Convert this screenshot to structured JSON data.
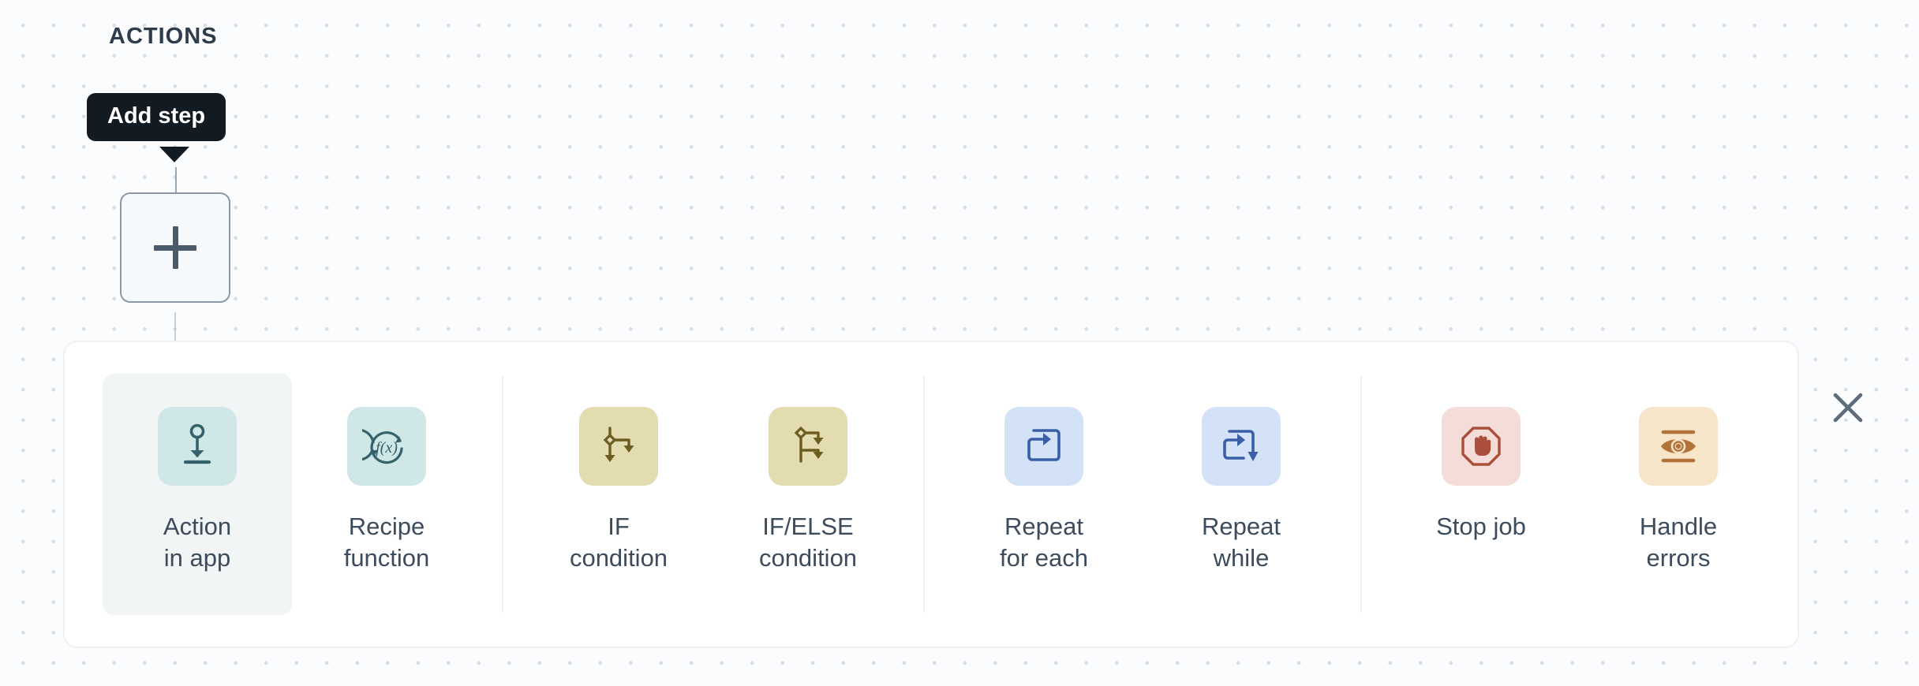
{
  "canvas": {
    "section_label": "ACTIONS",
    "background_color": "#fbfcfd",
    "dot_color": "#d9dde2"
  },
  "tooltip": {
    "text": "Add step",
    "background_color": "#121a22",
    "text_color": "#ffffff"
  },
  "add_step_button": {
    "icon": "plus-icon",
    "background_color": "#f6f9fb",
    "border_color": "#8b98a6"
  },
  "step_picker": {
    "background_color": "#ffffff",
    "border_color": "#eef1f4",
    "close_icon": "close-icon",
    "groups": [
      {
        "name": "app-actions",
        "items": [
          {
            "label": "Action\nin app",
            "icon": "download-to-line-icon",
            "icon_bg": "#cfe7e6",
            "icon_fg": "#35626a",
            "selected": true
          },
          {
            "label": "Recipe\nfunction",
            "icon": "function-loop-icon",
            "icon_bg": "#cfe7e6",
            "icon_fg": "#35626a",
            "selected": false
          }
        ]
      },
      {
        "name": "conditions",
        "items": [
          {
            "label": "IF\ncondition",
            "icon": "if-branch-icon",
            "icon_bg": "#e3dcb1",
            "icon_fg": "#6d5c20",
            "selected": false
          },
          {
            "label": "IF/ELSE\ncondition",
            "icon": "if-else-branch-icon",
            "icon_bg": "#e3dcb1",
            "icon_fg": "#6d5c20",
            "selected": false
          }
        ]
      },
      {
        "name": "loops",
        "items": [
          {
            "label": "Repeat\nfor each",
            "icon": "loop-arrow-icon",
            "icon_bg": "#d4e2f8",
            "icon_fg": "#3a5fa8",
            "selected": false
          },
          {
            "label": "Repeat\nwhile",
            "icon": "loop-while-arrow-icon",
            "icon_bg": "#d4e2f8",
            "icon_fg": "#3a5fa8",
            "selected": false
          }
        ]
      },
      {
        "name": "control",
        "items": [
          {
            "label": "Stop job",
            "icon": "stop-hand-icon",
            "icon_bg": "#f4dcd8",
            "icon_fg": "#ab4f3a",
            "selected": false
          },
          {
            "label": "Handle\nerrors",
            "icon": "eye-monitor-icon",
            "icon_bg": "#f7e5c9",
            "icon_fg": "#b2733a",
            "selected": false
          }
        ]
      }
    ]
  }
}
